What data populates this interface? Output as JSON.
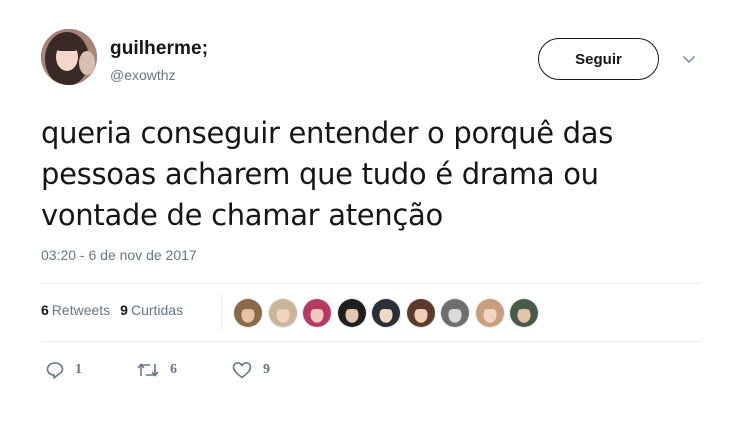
{
  "user": {
    "display_name": "guilherme;",
    "handle": "@exowthz",
    "avatar_icon": "profile-photo-avatar"
  },
  "follow_button": {
    "label": "Seguir"
  },
  "menu": {
    "icon": "chevron-down-icon"
  },
  "tweet": {
    "text_line1": "queria conseguir entender o porquê das",
    "text_line2": "pessoas acharem que tudo é drama ou",
    "text_line3": "vontade de chamar atenção",
    "timestamp": "03:20 - 6 de nov de 2017"
  },
  "stats": {
    "retweets_count": "6",
    "retweets_label": "Retweets",
    "likes_count": "9",
    "likes_label": "Curtidas"
  },
  "likers": [
    {
      "color": "#8a6a4a",
      "skin": "#e8c2a4"
    },
    {
      "color": "#c9b59b",
      "skin": "#f0d4bd"
    },
    {
      "color": "#b43b62",
      "skin": "#f1c8c0"
    },
    {
      "color": "#1f1f1f",
      "skin": "#e2c6b0"
    },
    {
      "color": "#2b2f38",
      "skin": "#efd9c6"
    },
    {
      "color": "#5a3b2b",
      "skin": "#efcfb4"
    },
    {
      "color": "#6e6e6e",
      "skin": "#dadada"
    },
    {
      "color": "#c6a07c",
      "skin": "#f0d6c2"
    },
    {
      "color": "#4a5a4a",
      "skin": "#e4c5a8"
    }
  ],
  "actions": {
    "reply_count": "1",
    "retweet_count": "6",
    "like_count": "9",
    "reply_icon": "reply-icon",
    "retweet_icon": "retweet-icon",
    "like_icon": "heart-icon"
  },
  "colors": {
    "text_primary": "#14171a",
    "text_secondary": "#657786",
    "divider": "#e6ecf0"
  }
}
